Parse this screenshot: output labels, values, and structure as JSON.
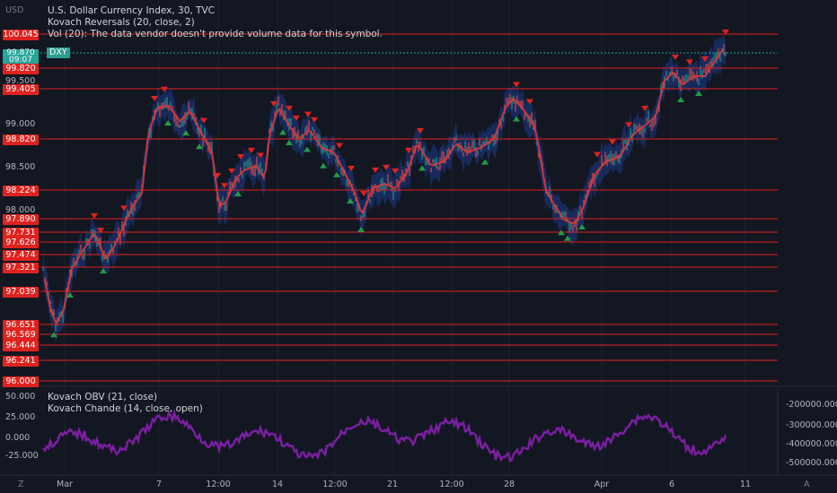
{
  "title": "U.S. Dollar Currency Index, 30, TVC",
  "indicators": {
    "kovach_reversals": "Kovach Reversals (20, close, 2)",
    "volume": "Vol (20): The data vendor doesn't provide volume data for this symbol.",
    "obv": "Kovach OBV (21, close)",
    "chande": "Kovach Chande (14, close, open)"
  },
  "currency": "USD",
  "symbol_tag": "DXY",
  "current_price": {
    "value": "99.870",
    "countdown": "09:07"
  },
  "level_labels": [
    "100.045",
    "99.820",
    "99.405",
    "98.820",
    "98.224",
    "97.890",
    "97.731",
    "97.626",
    "97.474",
    "97.321",
    "97.039",
    "96.651",
    "96.569",
    "96.444",
    "96.241",
    "96.000"
  ],
  "price_axis_ticks": [
    "99.500",
    "99.000",
    "98.500",
    "98.000"
  ],
  "osc_left_ticks": [
    "50.000",
    "25.000",
    "0.000",
    "-25.000"
  ],
  "osc_right_ticks": [
    "-200000.000",
    "-300000.000",
    "-400000.000",
    "-500000.000"
  ],
  "x_ticks": [
    "Mar",
    "7",
    "12:00",
    "14",
    "12:00",
    "21",
    "12:00",
    "28",
    "Apr",
    "6",
    "11"
  ],
  "corner_left": "Z",
  "corner_right": "A",
  "colors": {
    "background": "#131722",
    "level_line": "#e0221e",
    "price_band": "#1e3a8a",
    "moving_average": "#e53935",
    "up_marker": "#1e9e4a",
    "down_marker": "#e0221e",
    "oscillator": "#7b1fa2"
  }
}
